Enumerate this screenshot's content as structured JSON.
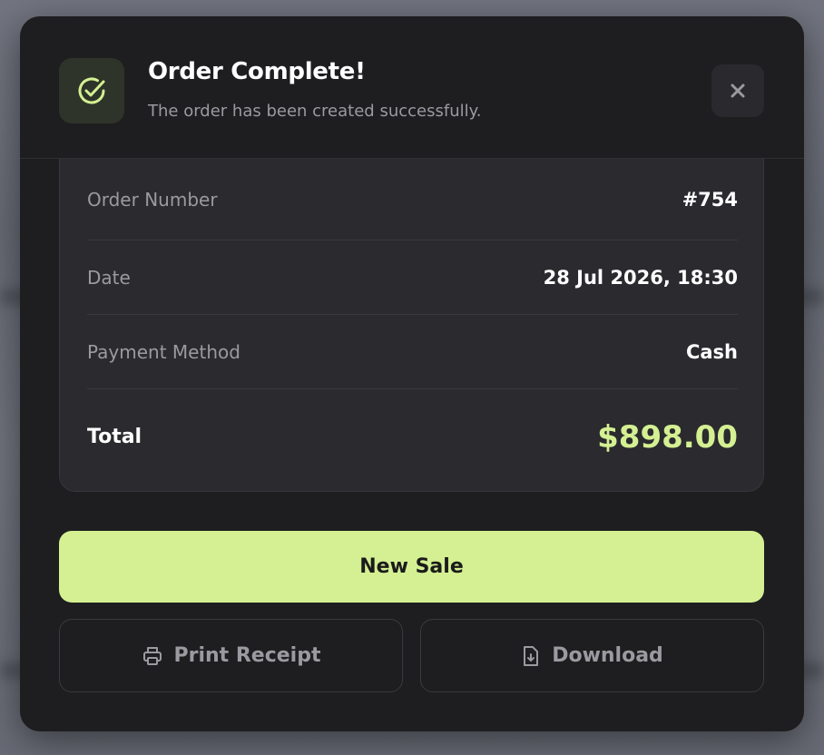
{
  "modal": {
    "title": "Order Complete!",
    "subtitle": "The order has been created successfully."
  },
  "details": {
    "order_number_label": "Order Number",
    "order_number_value": "#754",
    "date_label": "Date",
    "date_value": "28 Jul 2026, 18:30",
    "payment_label": "Payment Method",
    "payment_value": "Cash",
    "total_label": "Total",
    "total_value": "$898.00"
  },
  "actions": {
    "new_sale": "New Sale",
    "print_receipt": "Print Receipt",
    "download": "Download"
  },
  "icons": {
    "success": "check-circle-icon",
    "close": "close-icon",
    "print": "printer-icon",
    "download": "file-download-icon"
  },
  "colors": {
    "accent": "#d4f092",
    "modal_bg": "#1e1e20",
    "card_bg": "#2a2a2f"
  }
}
